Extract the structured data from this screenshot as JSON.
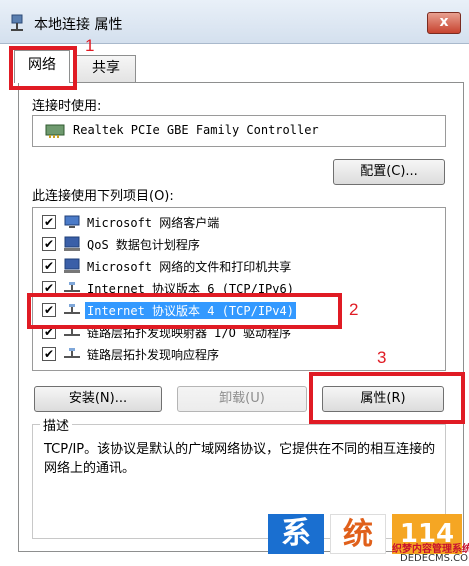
{
  "window": {
    "title": "本地连接 属性",
    "close_label": "x"
  },
  "tabs": [
    {
      "label": "网络"
    },
    {
      "label": "共享"
    }
  ],
  "connect_using": {
    "label": "连接时使用:",
    "adapter": "Realtek PCIe GBE Family Controller"
  },
  "configure_button": "配置(C)...",
  "items_label": "此连接使用下列项目(O):",
  "items": [
    {
      "label": "Microsoft 网络客户端",
      "checked": true
    },
    {
      "label": "QoS 数据包计划程序",
      "checked": true
    },
    {
      "label": "Microsoft 网络的文件和打印机共享",
      "checked": true
    },
    {
      "label": "Internet 协议版本 6 (TCP/IPv6)",
      "checked": true
    },
    {
      "label": "Internet 协议版本 4 (TCP/IPv4)",
      "checked": true,
      "selected": true
    },
    {
      "label": "链路层拓扑发现映射器 I/O 驱动程序",
      "checked": true
    },
    {
      "label": "链路层拓扑发现响应程序",
      "checked": true
    }
  ],
  "buttons": {
    "install": "安装(N)...",
    "uninstall": "卸载(U)",
    "properties": "属性(R)"
  },
  "description": {
    "legend": "描述",
    "text": "TCP/IP。该协议是默认的广域网络协议，它提供在不同的相互连接的网络上的通讯。"
  },
  "annotations": {
    "n1": "1",
    "n2": "2",
    "n3": "3"
  },
  "watermark": {
    "c1": "系",
    "c2": "统",
    "c3": "114",
    "line1": "织梦内容管理系统",
    "line2": "DEDECMS.COM"
  },
  "colors": {
    "highlight": "#e01b24",
    "selection": "#3399ff"
  }
}
